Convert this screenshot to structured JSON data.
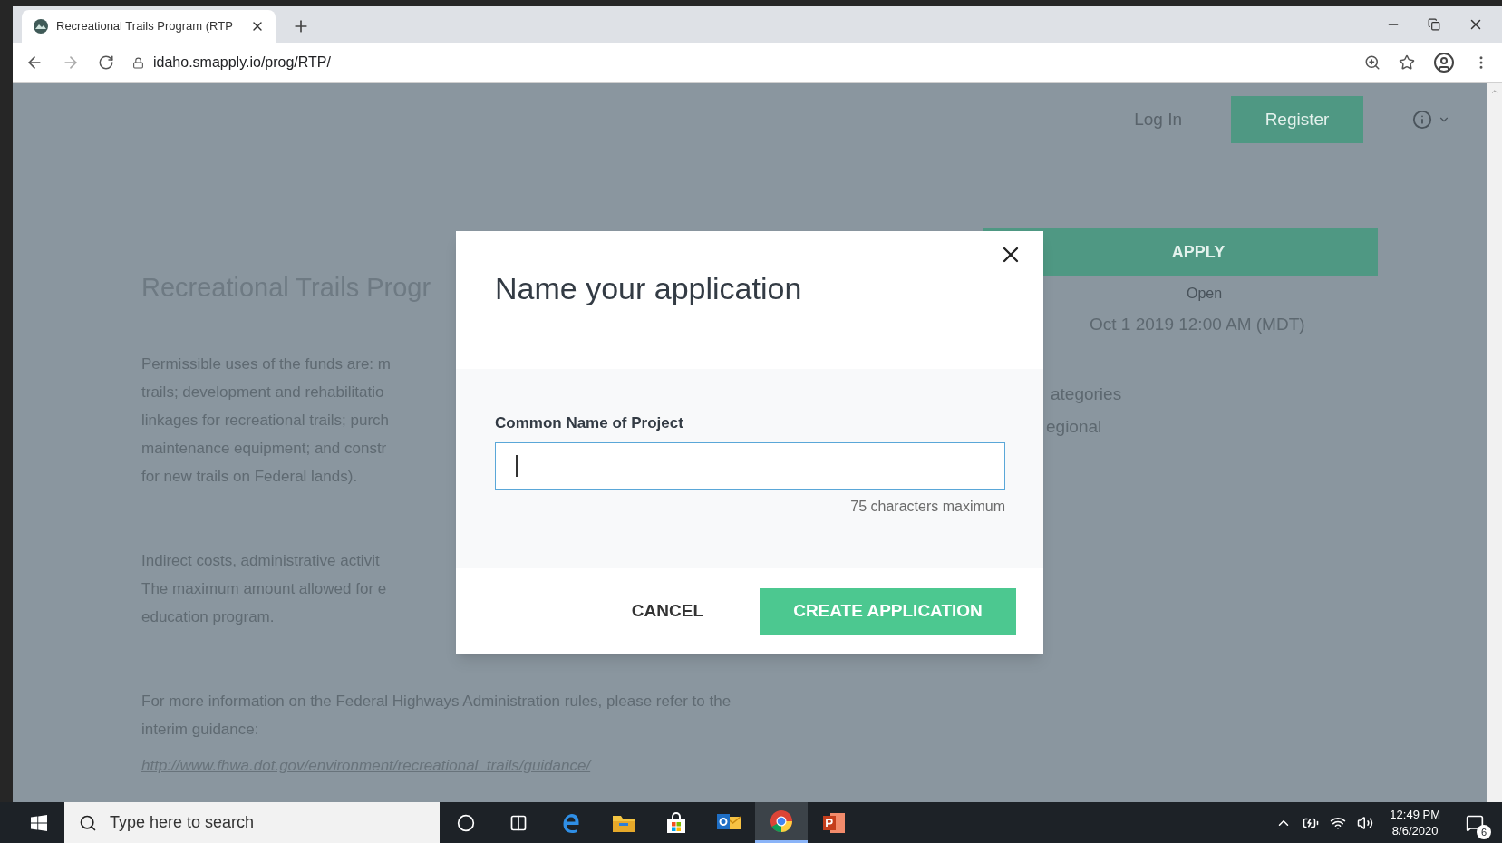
{
  "browser": {
    "tab": {
      "title": "Recreational Trails Program (RTP"
    },
    "address": "idaho.smapply.io/prog/RTP/"
  },
  "page": {
    "nav": {
      "login": "Log In",
      "register": "Register"
    },
    "title": "Recreational Trails Progr",
    "paragraphs": [
      {
        "lines": [
          "Permissible uses of the funds are: m",
          "trails; development and rehabilitatio",
          "linkages for recreational trails; purch",
          "maintenance equipment; and constr",
          "for new trails on Federal lands)."
        ]
      },
      {
        "lines": [
          "Indirect costs, administrative activit",
          "The maximum amount allowed for e",
          "education program."
        ]
      },
      {
        "lines": [
          "For more information on the Federal Highways Administration rules, please refer to the",
          "interim guidance:"
        ]
      }
    ],
    "link": "http://www.fhwa.dot.gov/environment/recreational_trails/guidance/",
    "sidebar": {
      "apply": "APPLY",
      "open_label": "Open",
      "open_date": "Oct 1 2019 12:00 AM (MDT)",
      "categories_label": "ategories",
      "category": "egional"
    }
  },
  "dialog": {
    "title": "Name your application",
    "field": {
      "label": "Common Name of Project",
      "hint": "75 characters maximum"
    },
    "buttons": [
      {
        "label": "CANCEL",
        "kind": "text"
      },
      {
        "label": "CREATE APPLICATION",
        "kind": "primary"
      }
    ]
  },
  "taskbar": {
    "search_placeholder": "Type here to search",
    "apps": [
      {
        "kind": "cortana",
        "selected": false
      },
      {
        "kind": "taskview",
        "selected": false
      },
      {
        "kind": "edge",
        "selected": false
      },
      {
        "kind": "explorer",
        "selected": false
      },
      {
        "kind": "store",
        "selected": false
      },
      {
        "kind": "mail",
        "selected": false
      },
      {
        "kind": "chrome",
        "selected": true
      },
      {
        "kind": "slides",
        "selected": false
      }
    ],
    "time": "12:49 PM",
    "date": "8/6/2020",
    "notifications": "6"
  }
}
